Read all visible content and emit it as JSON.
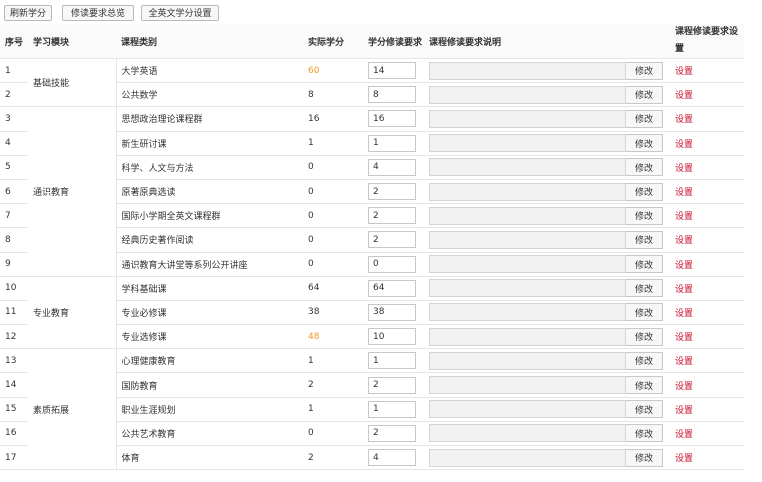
{
  "toolbar": {
    "refresh_label": "刷新学分",
    "overview_label": "修读要求总览",
    "english_label": "全英文学分设置"
  },
  "columns": {
    "index": "序号",
    "module": "学习模块",
    "category": "课程类别",
    "actual": "实际学分",
    "required": "学分修读要求",
    "note": "课程修读要求说明",
    "setting": "课程修读要求设置"
  },
  "edit_label": "修改",
  "setting_label": "设置",
  "colors": {
    "warning": "#f59a23",
    "link": "#c8102e"
  },
  "modules": [
    "基础技能",
    "通识教育",
    "专业教育",
    "素质拓展"
  ],
  "rows": [
    {
      "index": "1",
      "category": "大学英语",
      "actual": "60",
      "required": "14",
      "warn": true
    },
    {
      "index": "2",
      "category": "公共数学",
      "actual": "8",
      "required": "8",
      "warn": false
    },
    {
      "index": "3",
      "category": "思想政治理论课程群",
      "actual": "16",
      "required": "16",
      "warn": false
    },
    {
      "index": "4",
      "category": "新生研讨课",
      "actual": "1",
      "required": "1",
      "warn": false
    },
    {
      "index": "5",
      "category": "科学、人文与方法",
      "actual": "0",
      "required": "4",
      "warn": false
    },
    {
      "index": "6",
      "category": "原著原典选读",
      "actual": "0",
      "required": "2",
      "warn": false
    },
    {
      "index": "7",
      "category": "国际小学期全英文课程群",
      "actual": "0",
      "required": "2",
      "warn": false
    },
    {
      "index": "8",
      "category": "经典历史著作阅读",
      "actual": "0",
      "required": "2",
      "warn": false
    },
    {
      "index": "9",
      "category": "通识教育大讲堂等系列公开讲座",
      "actual": "0",
      "required": "0",
      "warn": false
    },
    {
      "index": "10",
      "category": "学科基础课",
      "actual": "64",
      "required": "64",
      "warn": false
    },
    {
      "index": "11",
      "category": "专业必修课",
      "actual": "38",
      "required": "38",
      "warn": false
    },
    {
      "index": "12",
      "category": "专业选修课",
      "actual": "48",
      "required": "10",
      "warn": true
    },
    {
      "index": "13",
      "category": "心理健康教育",
      "actual": "1",
      "required": "1",
      "warn": false
    },
    {
      "index": "14",
      "category": "国防教育",
      "actual": "2",
      "required": "2",
      "warn": false
    },
    {
      "index": "15",
      "category": "职业生涯规划",
      "actual": "1",
      "required": "1",
      "warn": false
    },
    {
      "index": "16",
      "category": "公共艺术教育",
      "actual": "0",
      "required": "2",
      "warn": false
    },
    {
      "index": "17",
      "category": "体育",
      "actual": "2",
      "required": "4",
      "warn": false
    }
  ]
}
